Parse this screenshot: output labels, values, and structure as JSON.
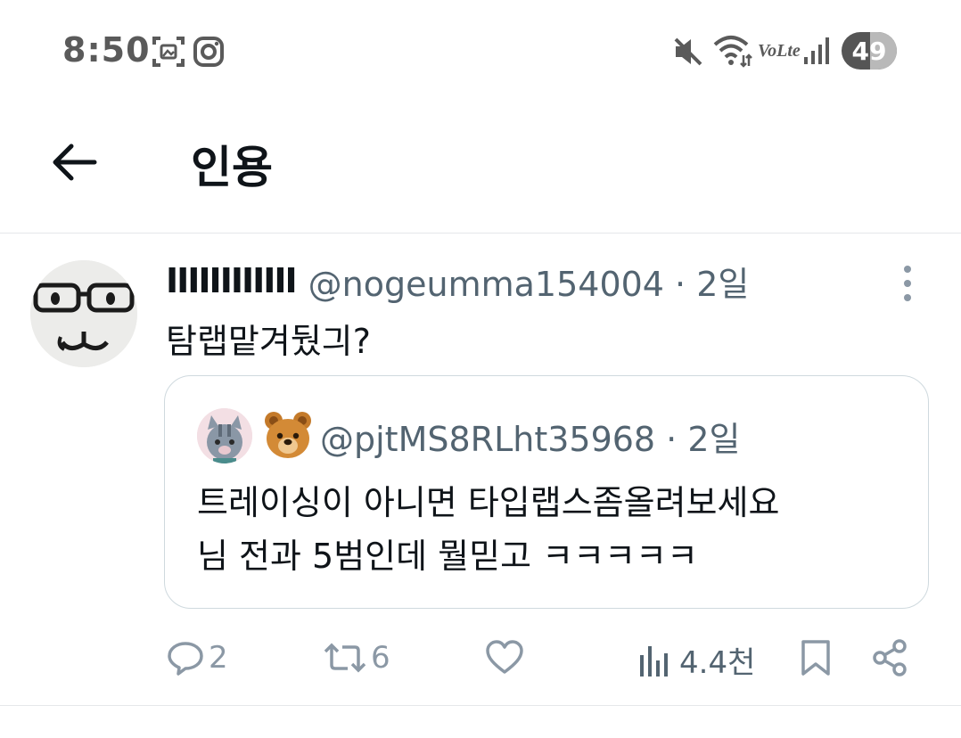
{
  "status_bar": {
    "time": "8:50",
    "battery_level": "49",
    "icons": [
      "screenshot-icon",
      "instagram-icon",
      "mute-icon",
      "wifi-icon",
      "volte-icon",
      "signal-icon"
    ],
    "volte_label": "VoLte"
  },
  "header": {
    "back_icon": "arrow-left-icon",
    "title": "인용"
  },
  "tweet": {
    "display_name": "IIIIIIIIIIII",
    "handle": "@nogeumma154004 · 2일",
    "text": "탐랩맡겨뒀긔?",
    "quote": {
      "emoji": "🐻",
      "handle": "@pjtMS8RLht35968 · 2일",
      "text_line1": "트레이싱이 아니면 타입랩스좀올려보세요",
      "text_line2": "님 전과 5범인데 뭘믿고 ㅋㅋㅋㅋㅋ"
    },
    "actions": {
      "reply_count": "2",
      "retweet_count": "6",
      "like_count": "",
      "views_count": "4.4천"
    }
  },
  "colors": {
    "text": "#0f1419",
    "secondary": "#536471",
    "icon_gray": "#8b98a5",
    "border": "#cfd9de"
  }
}
